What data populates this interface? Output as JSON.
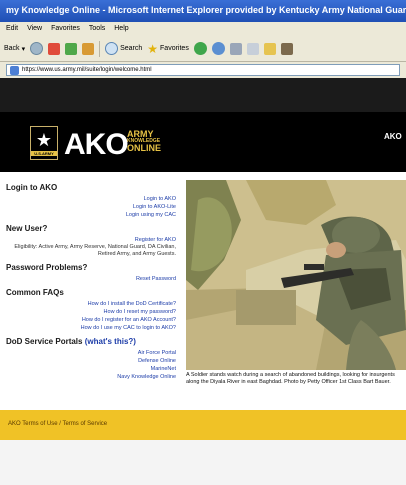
{
  "window": {
    "title": "my Knowledge Online - Microsoft Internet Explorer provided by Kentucky Army National Guard"
  },
  "menu": [
    "Edit",
    "View",
    "Favorites",
    "Tools",
    "Help"
  ],
  "toolbar": {
    "back_label": "Back",
    "search_label": "Search",
    "favorites_label": "Favorites"
  },
  "address": {
    "url": "https://www.us.army.mil/suite/login/welcome.html"
  },
  "header": {
    "logo_badge": "U.S.ARMY",
    "brand": "AKO",
    "brand_line1": "ARMY",
    "brand_line2": "KNOWLEDGE",
    "brand_line3": "ONLINE",
    "right_text": "AKO"
  },
  "sidebar": {
    "login": {
      "title": "Login to AKO",
      "links": [
        "Login to AKO",
        "Login to AKO-Lite",
        "Login using my CAC"
      ]
    },
    "new_user": {
      "title": "New User?",
      "link": "Register for AKO",
      "eligibility": "Eligibility: Active Army, Army Reserve, National Guard, DA Civilian, Retired Army, and Army Guests."
    },
    "password": {
      "title": "Password Problems?",
      "link": "Reset Password"
    },
    "faqs": {
      "title": "Common FAQs",
      "links": [
        "How do I install the DoD Certificate?",
        "How do I reset my password?",
        "How do I register for an AKO Account?",
        "How do I use my CAC to login to AKO?"
      ]
    },
    "portals": {
      "title": "DoD Service Portals",
      "whats_this": "(what's this?)",
      "links": [
        "Air Force Portal",
        "Defense Online",
        "MarineNet",
        "Navy Knowledge Online"
      ]
    }
  },
  "photo": {
    "caption": "A Soldier stands watch during a search of abandoned buildings, looking for insurgents along the Diyala River in east Baghdad. Photo by Petty Officer 1st Class Bart Bauer."
  },
  "footer": {
    "links": "AKO Terms of Use / Terms of Service"
  },
  "colors": {
    "accent_gold": "#f0c226",
    "link_blue": "#1c3ca8",
    "header_black": "#000000"
  }
}
